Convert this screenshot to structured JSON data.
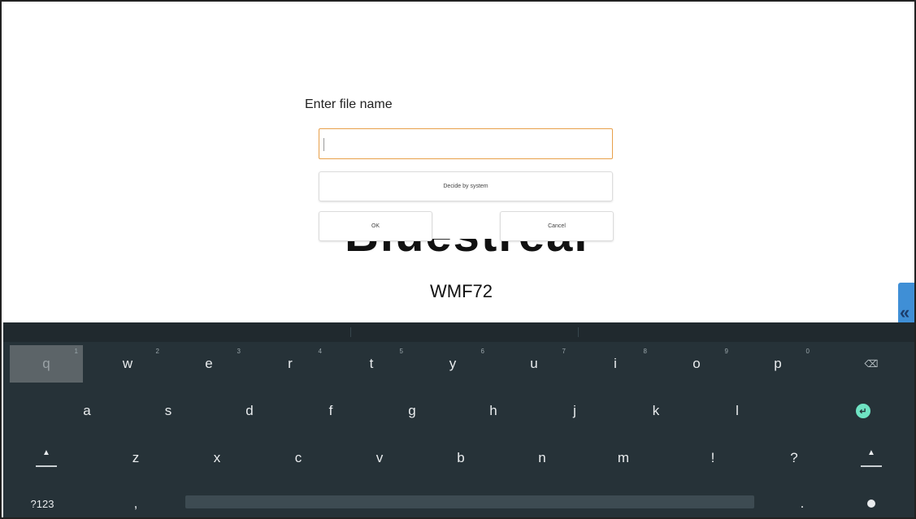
{
  "background": {
    "title": "Bluestream",
    "subtitle": "WMF72"
  },
  "dialog": {
    "title": "Enter file name",
    "input_value": "",
    "decide_label": "Decide by system",
    "ok_label": "OK",
    "cancel_label": "Cancel"
  },
  "side_handle": {
    "icon": "double-chevron-left-icon",
    "glyph": "«"
  },
  "keyboard": {
    "row1": [
      {
        "label": "q",
        "hint": "1"
      },
      {
        "label": "w",
        "hint": "2"
      },
      {
        "label": "e",
        "hint": "3"
      },
      {
        "label": "r",
        "hint": "4"
      },
      {
        "label": "t",
        "hint": "5"
      },
      {
        "label": "y",
        "hint": "6"
      },
      {
        "label": "u",
        "hint": "7"
      },
      {
        "label": "i",
        "hint": "8"
      },
      {
        "label": "o",
        "hint": "9"
      },
      {
        "label": "p",
        "hint": "0"
      }
    ],
    "row2": [
      "a",
      "s",
      "d",
      "f",
      "g",
      "h",
      "j",
      "k",
      "l"
    ],
    "row3": [
      "z",
      "x",
      "c",
      "v",
      "b",
      "n",
      "m",
      "!",
      "?"
    ],
    "symbols_label": "?123",
    "comma_label": ",",
    "period_label": ".",
    "icons": {
      "backspace": "backspace-icon",
      "enter": "enter-icon",
      "shift": "shift-icon",
      "emoji": "emoji-icon"
    },
    "colors": {
      "background": "#263238",
      "active_key": "#5c6468",
      "enter": "#6fe3c3"
    }
  },
  "colors": {
    "input_border": "#e8a04a",
    "side_handle": "#3f8fd6"
  }
}
